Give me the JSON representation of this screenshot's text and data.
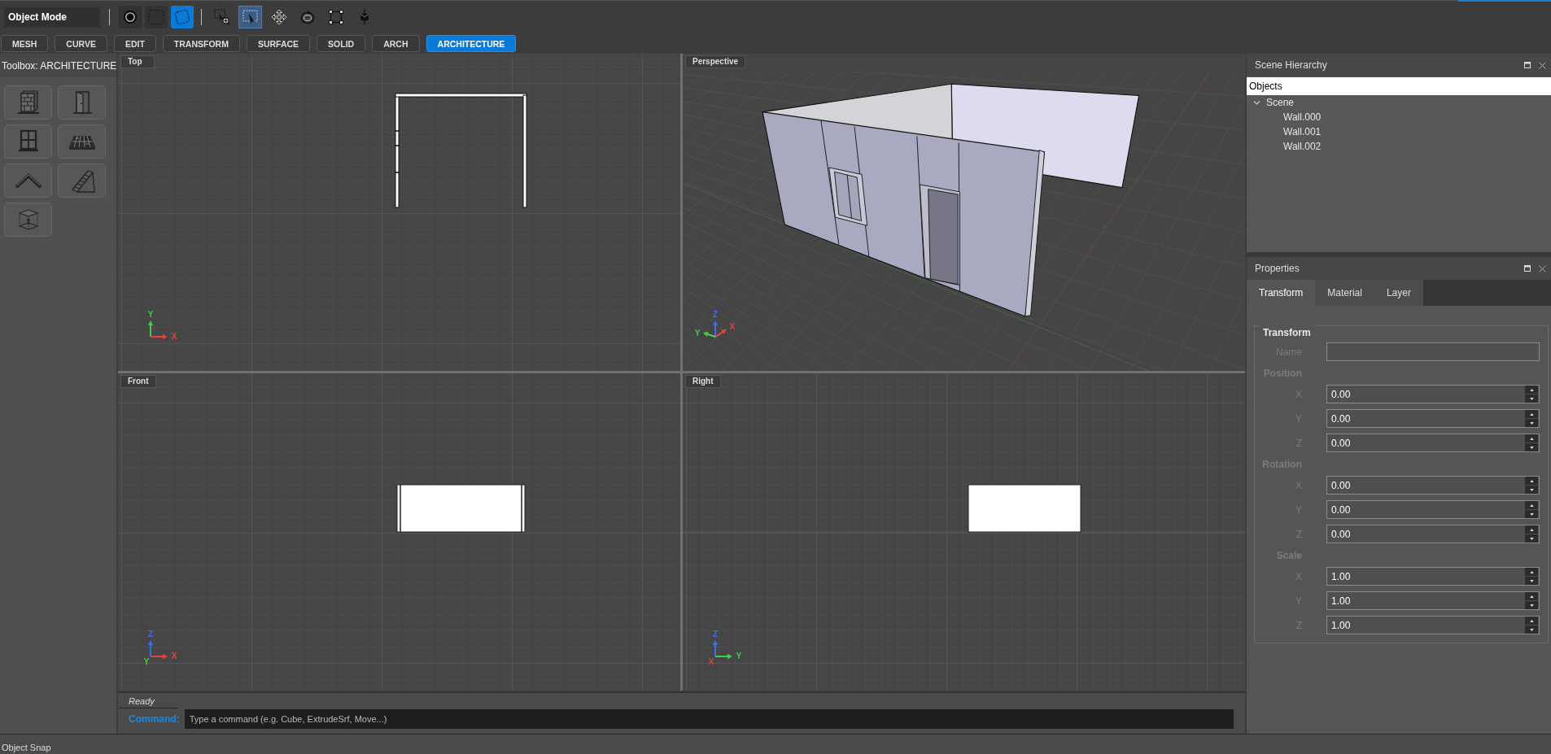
{
  "toolbar": {
    "mode": "Object Mode",
    "display_tools": [
      {
        "kind": "ring",
        "selected": false
      },
      {
        "kind": "square",
        "selected": false
      },
      {
        "kind": "tilted",
        "selected": true
      }
    ],
    "tools": [
      {
        "kind": "inspect",
        "selected": false
      },
      {
        "kind": "select",
        "selected": true
      },
      {
        "kind": "move",
        "selected": false
      },
      {
        "kind": "rotate",
        "selected": false
      },
      {
        "kind": "scale",
        "selected": false
      },
      {
        "kind": "gizmo",
        "selected": false
      }
    ]
  },
  "tabs": [
    {
      "label": "MESH",
      "selected": false
    },
    {
      "label": "CURVE",
      "selected": false
    },
    {
      "label": "EDIT",
      "selected": false
    },
    {
      "label": "TRANSFORM",
      "selected": false
    },
    {
      "label": "SURFACE",
      "selected": false
    },
    {
      "label": "SOLID",
      "selected": false
    },
    {
      "label": "ARCH",
      "selected": false
    },
    {
      "label": "ARCHITECTURE",
      "selected": true
    }
  ],
  "toolbox": {
    "title": "Toolbox: ARCHITECTURE",
    "tools": [
      {
        "kind": "wall"
      },
      {
        "kind": "door"
      },
      {
        "kind": "window"
      },
      {
        "kind": "floor"
      },
      {
        "kind": "roof"
      },
      {
        "kind": "stairs"
      },
      {
        "kind": "space"
      }
    ]
  },
  "viewports": [
    {
      "label": "Top",
      "kind": "top",
      "axes": [
        {
          "label": "Y",
          "color": "#3fd13f",
          "kind": "up"
        },
        {
          "label": "X",
          "color": "#e8413c",
          "kind": "right"
        }
      ]
    },
    {
      "label": "Perspective",
      "kind": "perspective",
      "axes": [
        {
          "label": "Z",
          "color": "#3c6cf0",
          "kind": "up"
        },
        {
          "label": "Y",
          "color": "#3fd13f",
          "kind": "leftup"
        },
        {
          "label": "X",
          "color": "#e8413c",
          "kind": "rightup"
        }
      ]
    },
    {
      "label": "Front",
      "kind": "front",
      "axes": [
        {
          "label": "Z",
          "color": "#3c6cf0",
          "kind": "up"
        },
        {
          "label": "Y",
          "color": "#3fd13f",
          "kind": "origin"
        },
        {
          "label": "X",
          "color": "#e8413c",
          "kind": "right"
        }
      ]
    },
    {
      "label": "Right",
      "kind": "right",
      "axes": [
        {
          "label": "Z",
          "color": "#3c6cf0",
          "kind": "up"
        },
        {
          "label": "X",
          "color": "#e8413c",
          "kind": "origin"
        },
        {
          "label": "Y",
          "color": "#3fd13f",
          "kind": "right"
        }
      ]
    }
  ],
  "scene_hierarchy": {
    "title": "Scene Hierarchy",
    "column": "Objects",
    "tree": [
      {
        "label": "Scene",
        "expanded": true,
        "children": [
          {
            "label": "Wall.000"
          },
          {
            "label": "Wall.001"
          },
          {
            "label": "Wall.002"
          }
        ]
      }
    ]
  },
  "properties": {
    "title": "Properties",
    "tabs": [
      {
        "label": "Transform",
        "selected": true
      },
      {
        "label": "Material",
        "selected": false
      },
      {
        "label": "Layer",
        "selected": false
      }
    ],
    "group": {
      "title": "Transform",
      "name_label": "Name",
      "sections": [
        {
          "title": "Position",
          "fields": [
            {
              "label": "X",
              "value": "0.00"
            },
            {
              "label": "Y",
              "value": "0.00"
            },
            {
              "label": "Z",
              "value": "0.00"
            }
          ]
        },
        {
          "title": "Rotation",
          "fields": [
            {
              "label": "X",
              "value": "0.00"
            },
            {
              "label": "Y",
              "value": "0.00"
            },
            {
              "label": "Z",
              "value": "0.00"
            }
          ]
        },
        {
          "title": "Scale",
          "fields": [
            {
              "label": "X",
              "value": "1.00"
            },
            {
              "label": "Y",
              "value": "1.00"
            },
            {
              "label": "Z",
              "value": "1.00"
            }
          ]
        }
      ]
    }
  },
  "command": {
    "status": "Ready",
    "label": "Command:",
    "placeholder": "Type a command (e.g. Cube, ExtrudeSrf, Move...)"
  },
  "status_bar": {
    "text": "Object Snap"
  }
}
